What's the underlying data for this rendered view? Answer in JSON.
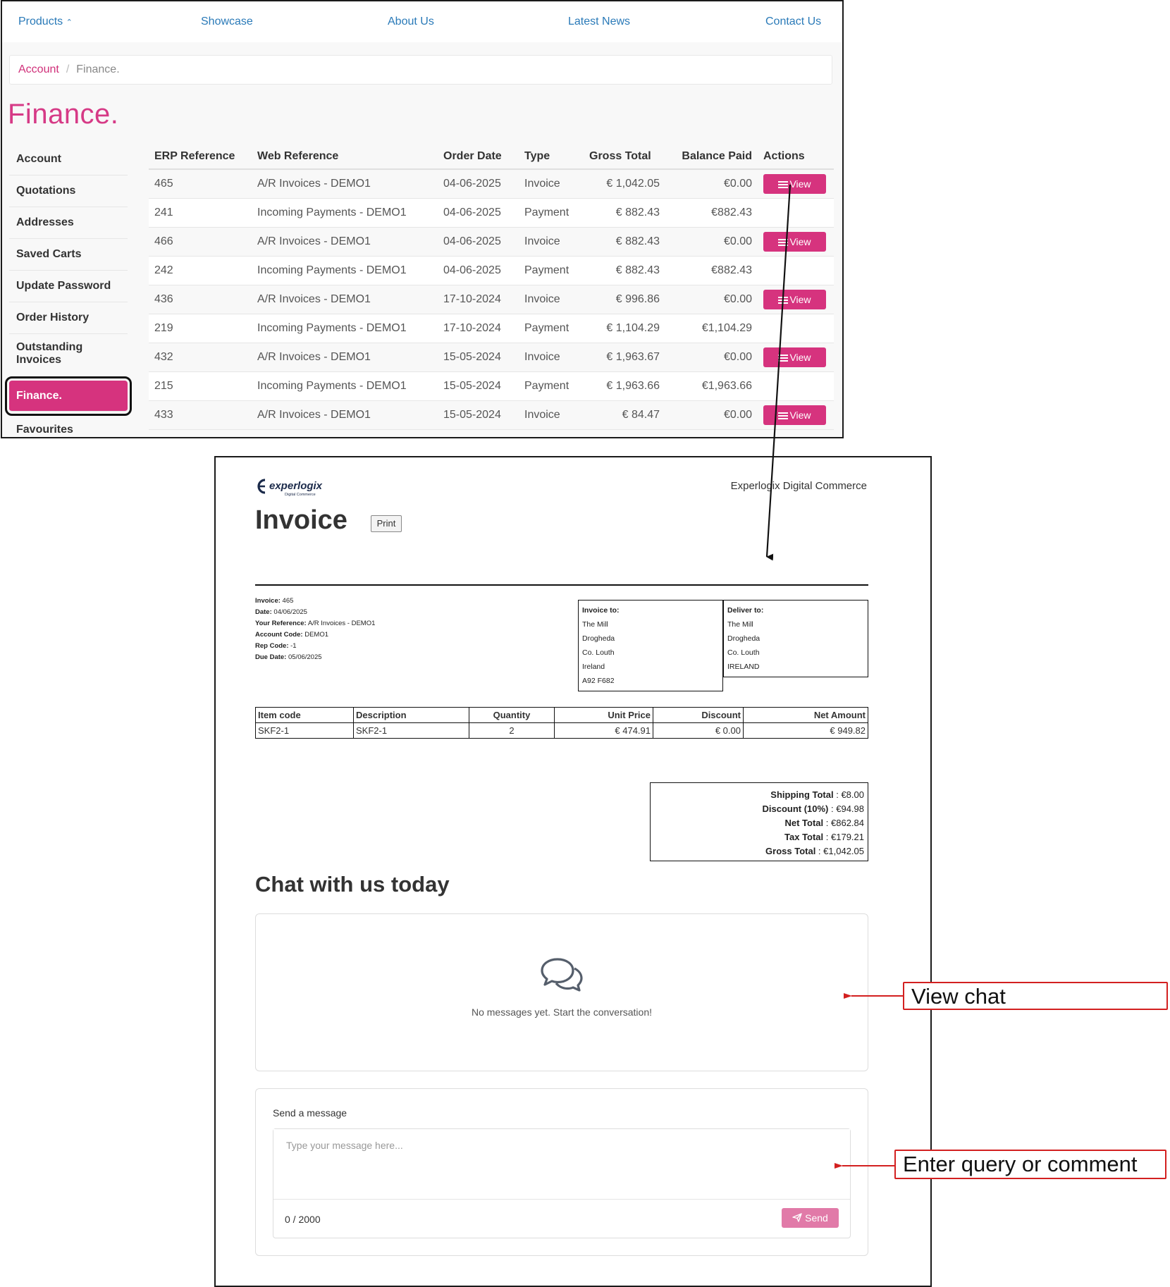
{
  "nav": {
    "items": [
      "Products",
      "Showcase",
      "About Us",
      "Latest News",
      "Contact Us"
    ]
  },
  "breadcrumb": {
    "parent": "Account",
    "separator": "/",
    "current": "Finance."
  },
  "page_title": "Finance.",
  "sidebar": {
    "items": [
      "Account",
      "Quotations",
      "Addresses",
      "Saved Carts",
      "Update Password",
      "Order History",
      "Outstanding Invoices",
      "Finance.",
      "Favourites"
    ],
    "active": "Finance."
  },
  "finance_table": {
    "headers": [
      "ERP Reference",
      "Web Reference",
      "Order Date",
      "Type",
      "Gross Total",
      "Balance Paid",
      "Actions"
    ],
    "rows": [
      [
        "465",
        "A/R Invoices - DEMO1",
        "04-06-2025",
        "Invoice",
        "€ 1,042.05",
        "€0.00",
        "View"
      ],
      [
        "241",
        "Incoming Payments - DEMO1",
        "04-06-2025",
        "Payment",
        "€ 882.43",
        "€882.43",
        ""
      ],
      [
        "466",
        "A/R Invoices - DEMO1",
        "04-06-2025",
        "Invoice",
        "€ 882.43",
        "€0.00",
        "View"
      ],
      [
        "242",
        "Incoming Payments - DEMO1",
        "04-06-2025",
        "Payment",
        "€ 882.43",
        "€882.43",
        ""
      ],
      [
        "436",
        "A/R Invoices - DEMO1",
        "17-10-2024",
        "Invoice",
        "€ 996.86",
        "€0.00",
        "View"
      ],
      [
        "219",
        "Incoming Payments - DEMO1",
        "17-10-2024",
        "Payment",
        "€ 1,104.29",
        "€1,104.29",
        ""
      ],
      [
        "432",
        "A/R Invoices - DEMO1",
        "15-05-2024",
        "Invoice",
        "€ 1,963.67",
        "€0.00",
        "View"
      ],
      [
        "215",
        "Incoming Payments - DEMO1",
        "15-05-2024",
        "Payment",
        "€ 1,963.66",
        "€1,963.66",
        ""
      ],
      [
        "433",
        "A/R Invoices - DEMO1",
        "15-05-2024",
        "Invoice",
        "€ 84.47",
        "€0.00",
        "View"
      ]
    ]
  },
  "invoice": {
    "logo_text": "experlogix",
    "logo_subtext": "Digital Commerce",
    "company": "Experlogix Digital Commerce",
    "title": "Invoice",
    "print_label": "Print",
    "meta": [
      {
        "label": "Invoice:",
        "value": "465"
      },
      {
        "label": "Date:",
        "value": "04/06/2025"
      },
      {
        "label": "Your Reference:",
        "value": "A/R Invoices - DEMO1"
      },
      {
        "label": "Account Code:",
        "value": "DEMO1"
      },
      {
        "label": "Rep Code:",
        "value": "-1"
      },
      {
        "label": "Due Date:",
        "value": "05/06/2025"
      }
    ],
    "invoice_to": {
      "heading": "Invoice to:",
      "lines": [
        "The Mill",
        "Drogheda",
        "Co. Louth",
        "Ireland",
        "A92 F682"
      ]
    },
    "deliver_to": {
      "heading": "Deliver to:",
      "lines": [
        "The Mill",
        "Drogheda",
        "Co. Louth",
        "IRELAND"
      ]
    },
    "items": {
      "headers": [
        "Item code",
        "Description",
        "Quantity",
        "Unit Price",
        "Discount",
        "Net Amount"
      ],
      "rows": [
        [
          "SKF2-1",
          "SKF2-1",
          "2",
          "€ 474.91",
          "€ 0.00",
          "€ 949.82"
        ]
      ]
    },
    "totals": [
      {
        "label": "Shipping Total",
        "value": "€8.00"
      },
      {
        "label": "Discount (10%)",
        "value": "€94.98"
      },
      {
        "label": "Net Total",
        "value": "€862.84"
      },
      {
        "label": "Tax Total",
        "value": "€179.21"
      },
      {
        "label": "Gross Total",
        "value": "€1,042.05"
      }
    ]
  },
  "chat": {
    "title": "Chat with us today",
    "empty_message": "No messages yet. Start the conversation!",
    "send_label": "Send a message",
    "placeholder": "Type your message here...",
    "counter": "0 / 2000",
    "send_button": "Send"
  },
  "annotations": {
    "view_chat": "View chat",
    "enter_query": "Enter query or comment"
  },
  "colors": {
    "brand_pink": "#d6337e",
    "link_blue": "#2a7ab8",
    "callout_red": "#d32020"
  }
}
